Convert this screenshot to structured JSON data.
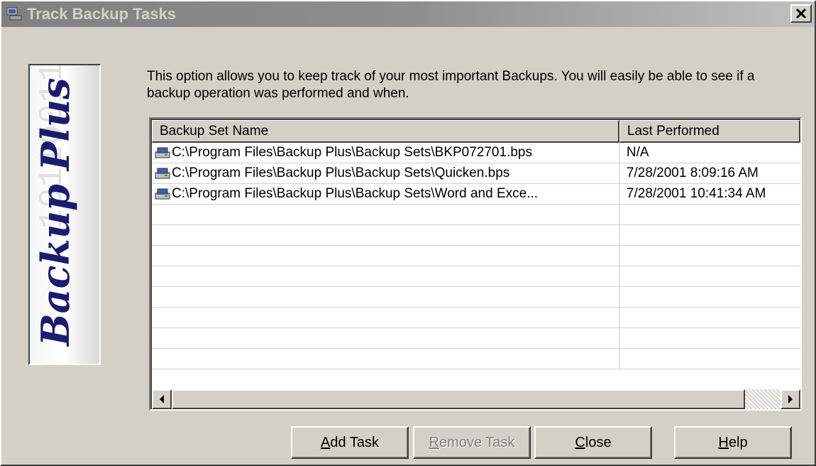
{
  "window": {
    "title": "Track Backup Tasks",
    "close_glyph": "✕"
  },
  "logo": {
    "text": "Backup Plus",
    "background_digits": "10110011001101",
    "icon": "computer-icon"
  },
  "description": "This option allows you to keep track of your most important Backups.  You will easily be able to see if a backup operation was performed and when.",
  "list": {
    "columns": [
      "Backup Set Name",
      "Last Performed"
    ],
    "rows": [
      {
        "name": "C:\\Program Files\\Backup Plus\\Backup Sets\\BKP072701.bps",
        "last": "N/A"
      },
      {
        "name": "C:\\Program Files\\Backup Plus\\Backup Sets\\Quicken.bps",
        "last": "7/28/2001 8:09:16 AM"
      },
      {
        "name": "C:\\Program Files\\Backup Plus\\Backup Sets\\Word and Exce...",
        "last": "7/28/2001 10:41:34 AM"
      }
    ],
    "row_icon": "disk-icon"
  },
  "buttons": {
    "add": {
      "mnemonic": "A",
      "rest": "dd Task"
    },
    "remove": {
      "mnemonic": "R",
      "rest": "emove Task",
      "disabled": true
    },
    "close": {
      "mnemonic": "C",
      "rest": "lose"
    },
    "help": {
      "mnemonic": "H",
      "rest": "elp"
    }
  },
  "colors": {
    "face": "#d4d0c8",
    "title_text": "#d4d0c8",
    "logo_text": "#1c1c6e",
    "disabled_text": "#808080"
  }
}
